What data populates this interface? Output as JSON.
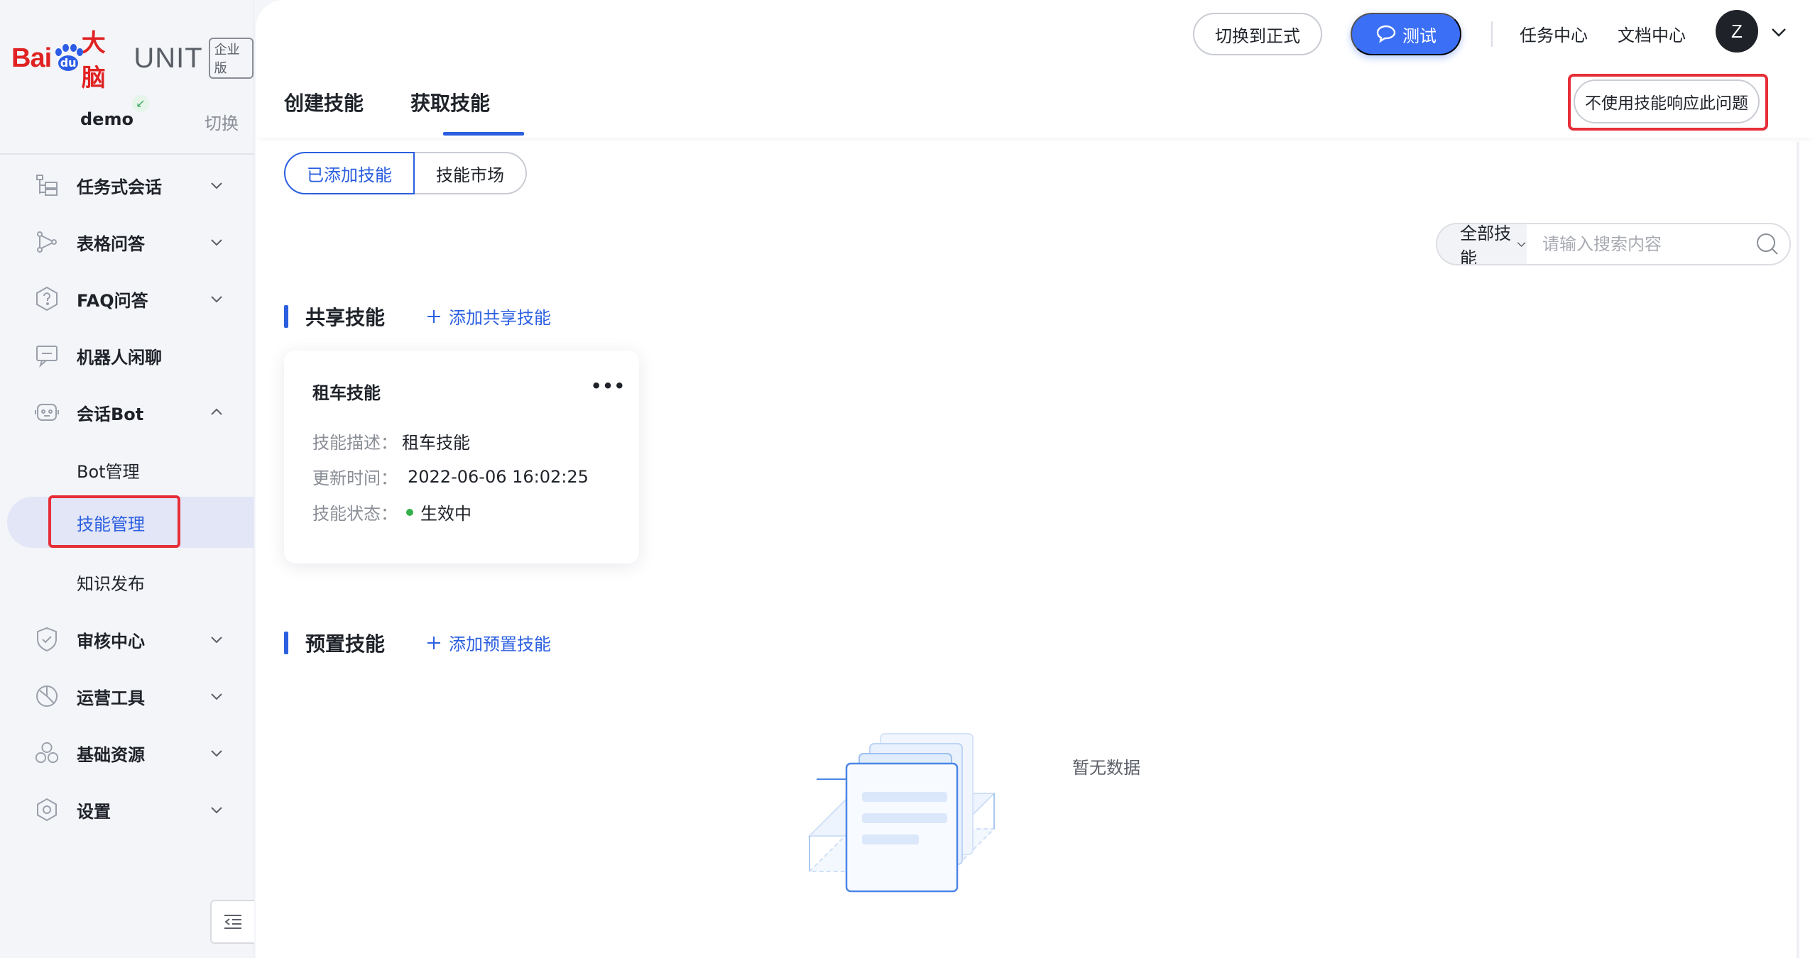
{
  "brand": {
    "logo_bai": "Bai",
    "logo_du": "du",
    "logo_dana": "大脑",
    "product": "UNIT",
    "edition": "企业版"
  },
  "workspace": {
    "name": "demo",
    "switch_label": "切换"
  },
  "sidebar": {
    "items": [
      {
        "label": "任务式会话",
        "icon": "task-dialog-icon"
      },
      {
        "label": "表格问答",
        "icon": "table-qa-icon"
      },
      {
        "label": "FAQ问答",
        "icon": "faq-icon"
      },
      {
        "label": "机器人闲聊",
        "icon": "chat-icon"
      },
      {
        "label": "会话Bot",
        "icon": "bot-icon"
      },
      {
        "label": "审核中心",
        "icon": "shield-icon"
      },
      {
        "label": "运营工具",
        "icon": "ops-tools-icon"
      },
      {
        "label": "基础资源",
        "icon": "resources-icon"
      },
      {
        "label": "设置",
        "icon": "gear-icon"
      }
    ],
    "bot_subitems": [
      {
        "label": "Bot管理"
      },
      {
        "label": "技能管理"
      },
      {
        "label": "知识发布"
      }
    ]
  },
  "header": {
    "switch_formal": "切换到正式",
    "test": "测试",
    "task_center": "任务中心",
    "doc_center": "文档中心",
    "avatar_letter": "Z"
  },
  "tabs": {
    "create": "创建技能",
    "get": "获取技能",
    "no_skill_button": "不使用技能响应此问题"
  },
  "segment": {
    "added": "已添加技能",
    "market": "技能市场"
  },
  "search": {
    "filter_label": "全部技能",
    "placeholder": "请输入搜索内容"
  },
  "shared_section": {
    "title": "共享技能",
    "add_label": "添加共享技能"
  },
  "skill_card": {
    "title": "租车技能",
    "more": "•••",
    "desc_key": "技能描述：",
    "desc_value": "租车技能",
    "updated_key": "更新时间：",
    "updated_value": "2022-06-06 16:02:25",
    "status_key": "技能状态：",
    "status_value": "生效中",
    "status_color": "#35b04a"
  },
  "preset_section": {
    "title": "预置技能",
    "add_label": "添加预置技能",
    "empty_text": "暂无数据"
  },
  "colors": {
    "accent": "#2b5fe0",
    "test_button": "#3b6ff5",
    "highlight_box": "#e62e38"
  }
}
